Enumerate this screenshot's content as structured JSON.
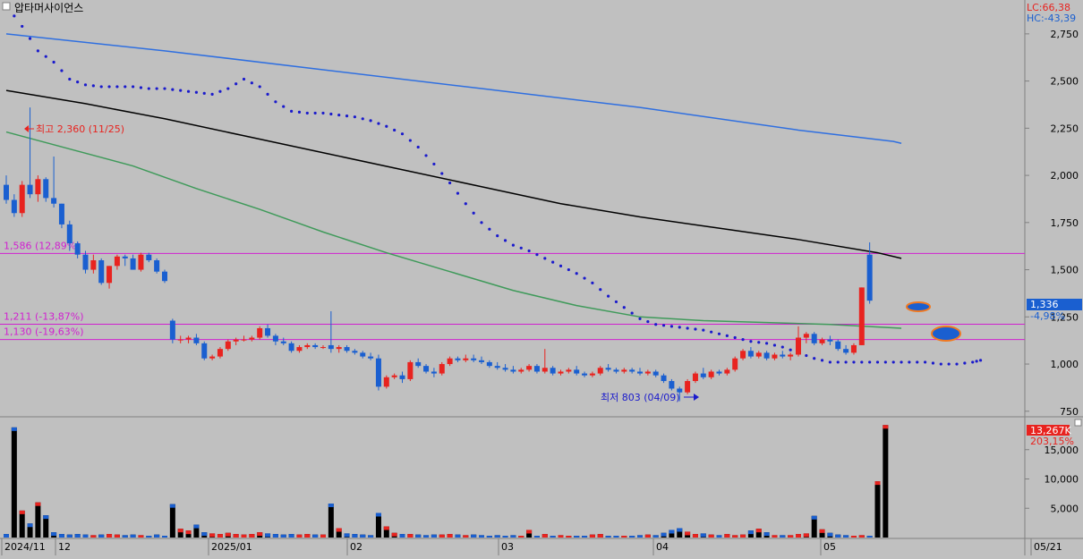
{
  "header": {
    "stock_name": "압타머사이언스",
    "lc_label": "LC:66,38",
    "hc_label": "HC:-43,39"
  },
  "colors": {
    "background": "#c0c0c0",
    "up": "#e8231f",
    "down": "#1a5fd0",
    "ma_blue": "#2f6fe0",
    "ma_black": "#000000",
    "ma_green": "#3f9a5a",
    "psar": "#1a1acc",
    "hline": "#d020d0",
    "annotation_high": "#e8231f",
    "annotation_low": "#1a1acc"
  },
  "chart_data": [
    {
      "type": "candlestick",
      "title": "",
      "y_ticks": [
        "2,750",
        "2,500",
        "2,250",
        "2,000",
        "1,750",
        "1,500",
        "1,250",
        "1,000",
        "750"
      ],
      "ylim": [
        730,
        2920
      ],
      "x_ticks": [
        "2024/11",
        "12",
        "2025/01",
        "02",
        "03",
        "04",
        "05",
        "05/21"
      ],
      "price_now_label": "1,336",
      "change_label": "-4,98%",
      "horizontal_lines": [
        {
          "value": 1586,
          "label": "1,586 (12,89%)"
        },
        {
          "value": 1211,
          "label": "1,211 (-13,87%)"
        },
        {
          "value": 1130,
          "label": "1,130 (-19,63%)"
        }
      ],
      "annotations": {
        "high_label": "최고 2,360 (11/25)",
        "low_label": "최저 803 (04/09)"
      },
      "candles": [
        [
          1950,
          2000,
          1850,
          1870
        ],
        [
          1870,
          1900,
          1780,
          1800
        ],
        [
          1800,
          1970,
          1780,
          1950
        ],
        [
          1950,
          2360,
          1880,
          1900
        ],
        [
          1900,
          2000,
          1860,
          1980
        ],
        [
          1980,
          1990,
          1860,
          1880
        ],
        [
          1880,
          2100,
          1830,
          1850
        ],
        [
          1850,
          1850,
          1720,
          1740
        ],
        [
          1740,
          1760,
          1600,
          1640
        ],
        [
          1640,
          1650,
          1560,
          1580
        ],
        [
          1580,
          1600,
          1480,
          1500
        ],
        [
          1500,
          1580,
          1480,
          1550
        ],
        [
          1550,
          1560,
          1420,
          1430
        ],
        [
          1430,
          1520,
          1400,
          1520
        ],
        [
          1520,
          1580,
          1500,
          1570
        ],
        [
          1570,
          1580,
          1520,
          1560
        ],
        [
          1560,
          1580,
          1500,
          1500
        ],
        [
          1500,
          1590,
          1490,
          1580
        ],
        [
          1580,
          1590,
          1540,
          1550
        ],
        [
          1550,
          1560,
          1480,
          1490
        ],
        [
          1490,
          1500,
          1430,
          1440
        ],
        [
          1230,
          1240,
          1110,
          1130
        ],
        [
          1130,
          1150,
          1110,
          1130
        ],
        [
          1130,
          1150,
          1110,
          1140
        ],
        [
          1140,
          1160,
          1100,
          1110
        ],
        [
          1110,
          1120,
          1020,
          1030
        ],
        [
          1030,
          1050,
          1020,
          1040
        ],
        [
          1040,
          1090,
          1030,
          1080
        ],
        [
          1080,
          1130,
          1070,
          1120
        ],
        [
          1120,
          1140,
          1100,
          1130
        ],
        [
          1130,
          1150,
          1120,
          1130
        ],
        [
          1130,
          1150,
          1120,
          1140
        ],
        [
          1140,
          1200,
          1130,
          1190
        ],
        [
          1190,
          1210,
          1140,
          1150
        ],
        [
          1150,
          1160,
          1100,
          1120
        ],
        [
          1120,
          1140,
          1100,
          1110
        ],
        [
          1110,
          1120,
          1060,
          1070
        ],
        [
          1070,
          1100,
          1060,
          1090
        ],
        [
          1090,
          1110,
          1080,
          1100
        ],
        [
          1100,
          1110,
          1080,
          1090
        ],
        [
          1090,
          1100,
          1080,
          1090
        ],
        [
          1100,
          1280,
          1060,
          1080
        ],
        [
          1080,
          1100,
          1060,
          1090
        ],
        [
          1090,
          1100,
          1060,
          1070
        ],
        [
          1070,
          1080,
          1050,
          1060
        ],
        [
          1060,
          1070,
          1030,
          1040
        ],
        [
          1040,
          1060,
          1020,
          1030
        ],
        [
          1030,
          1050,
          860,
          880
        ],
        [
          880,
          940,
          870,
          930
        ],
        [
          930,
          950,
          920,
          940
        ],
        [
          940,
          960,
          900,
          920
        ],
        [
          920,
          1020,
          910,
          1010
        ],
        [
          1010,
          1030,
          980,
          990
        ],
        [
          990,
          1000,
          950,
          960
        ],
        [
          960,
          980,
          930,
          950
        ],
        [
          950,
          1010,
          940,
          1000
        ],
        [
          1000,
          1040,
          990,
          1030
        ],
        [
          1030,
          1040,
          1010,
          1020
        ],
        [
          1020,
          1050,
          1010,
          1030
        ],
        [
          1030,
          1050,
          1010,
          1020
        ],
        [
          1020,
          1040,
          1000,
          1010
        ],
        [
          1010,
          1020,
          980,
          990
        ],
        [
          990,
          1010,
          970,
          980
        ],
        [
          980,
          1000,
          960,
          970
        ],
        [
          970,
          990,
          950,
          960
        ],
        [
          960,
          980,
          950,
          970
        ],
        [
          970,
          1000,
          960,
          990
        ],
        [
          990,
          1000,
          950,
          960
        ],
        [
          960,
          1080,
          950,
          980
        ],
        [
          980,
          990,
          940,
          950
        ],
        [
          950,
          970,
          940,
          960
        ],
        [
          960,
          980,
          950,
          970
        ],
        [
          970,
          990,
          940,
          950
        ],
        [
          950,
          960,
          930,
          940
        ],
        [
          940,
          960,
          930,
          950
        ],
        [
          950,
          990,
          940,
          980
        ],
        [
          980,
          1000,
          960,
          970
        ],
        [
          970,
          980,
          950,
          960
        ],
        [
          960,
          980,
          950,
          970
        ],
        [
          970,
          980,
          950,
          960
        ],
        [
          960,
          980,
          940,
          950
        ],
        [
          950,
          970,
          940,
          960
        ],
        [
          960,
          970,
          930,
          940
        ],
        [
          940,
          950,
          900,
          910
        ],
        [
          910,
          920,
          860,
          870
        ],
        [
          870,
          880,
          803,
          850
        ],
        [
          850,
          920,
          840,
          910
        ],
        [
          910,
          960,
          900,
          950
        ],
        [
          950,
          980,
          920,
          930
        ],
        [
          930,
          970,
          920,
          960
        ],
        [
          960,
          970,
          940,
          950
        ],
        [
          950,
          980,
          940,
          970
        ],
        [
          970,
          1040,
          960,
          1030
        ],
        [
          1030,
          1080,
          1020,
          1070
        ],
        [
          1070,
          1090,
          1030,
          1040
        ],
        [
          1040,
          1070,
          1030,
          1060
        ],
        [
          1060,
          1070,
          1020,
          1030
        ],
        [
          1030,
          1060,
          1020,
          1050
        ],
        [
          1050,
          1070,
          1030,
          1040
        ],
        [
          1040,
          1060,
          1020,
          1050
        ],
        [
          1050,
          1200,
          1040,
          1140
        ],
        [
          1140,
          1170,
          1110,
          1160
        ],
        [
          1160,
          1170,
          1100,
          1110
        ],
        [
          1110,
          1140,
          1100,
          1130
        ],
        [
          1130,
          1150,
          1100,
          1120
        ],
        [
          1120,
          1130,
          1070,
          1080
        ],
        [
          1080,
          1100,
          1050,
          1060
        ],
        [
          1060,
          1110,
          1050,
          1100
        ],
        [
          1100,
          1406,
          1100,
          1406
        ],
        [
          1580,
          1645,
          1320,
          1336
        ]
      ],
      "ma_blue": [
        [
          0,
          2750
        ],
        [
          20,
          2660
        ],
        [
          40,
          2560
        ],
        [
          60,
          2460
        ],
        [
          80,
          2360
        ],
        [
          100,
          2240
        ],
        [
          112,
          2180
        ],
        [
          113,
          2170
        ]
      ],
      "ma_black": [
        [
          0,
          2450
        ],
        [
          10,
          2380
        ],
        [
          20,
          2300
        ],
        [
          30,
          2210
        ],
        [
          40,
          2120
        ],
        [
          50,
          2030
        ],
        [
          60,
          1940
        ],
        [
          70,
          1850
        ],
        [
          80,
          1780
        ],
        [
          90,
          1720
        ],
        [
          100,
          1660
        ],
        [
          110,
          1590
        ],
        [
          113,
          1560
        ]
      ],
      "ma_green": [
        [
          0,
          2230
        ],
        [
          8,
          2140
        ],
        [
          16,
          2050
        ],
        [
          24,
          1930
        ],
        [
          32,
          1820
        ],
        [
          40,
          1700
        ],
        [
          48,
          1590
        ],
        [
          56,
          1490
        ],
        [
          64,
          1390
        ],
        [
          72,
          1310
        ],
        [
          80,
          1250
        ],
        [
          88,
          1230
        ],
        [
          96,
          1220
        ],
        [
          104,
          1210
        ],
        [
          113,
          1190
        ]
      ],
      "psar": [
        [
          0,
          2900
        ],
        [
          2,
          2790
        ],
        [
          4,
          2660
        ],
        [
          6,
          2600
        ],
        [
          8,
          2510
        ],
        [
          10,
          2480
        ],
        [
          12,
          2470
        ],
        [
          14,
          2470
        ],
        [
          16,
          2470
        ],
        [
          18,
          2460
        ],
        [
          20,
          2460
        ],
        [
          22,
          2450
        ],
        [
          24,
          2440
        ],
        [
          26,
          2430
        ],
        [
          28,
          2460
        ],
        [
          30,
          2510
        ],
        [
          32,
          2470
        ],
        [
          34,
          2390
        ],
        [
          36,
          2340
        ],
        [
          38,
          2330
        ],
        [
          40,
          2330
        ],
        [
          42,
          2320
        ],
        [
          44,
          2310
        ],
        [
          46,
          2290
        ],
        [
          48,
          2260
        ],
        [
          50,
          2220
        ],
        [
          52,
          2150
        ],
        [
          54,
          2060
        ],
        [
          56,
          1960
        ],
        [
          58,
          1850
        ],
        [
          60,
          1750
        ],
        [
          62,
          1680
        ],
        [
          64,
          1630
        ],
        [
          66,
          1600
        ],
        [
          68,
          1560
        ],
        [
          70,
          1520
        ],
        [
          72,
          1480
        ],
        [
          74,
          1430
        ],
        [
          76,
          1360
        ],
        [
          78,
          1300
        ],
        [
          80,
          1240
        ],
        [
          82,
          1210
        ],
        [
          84,
          1200
        ],
        [
          86,
          1190
        ],
        [
          88,
          1180
        ],
        [
          90,
          1160
        ],
        [
          92,
          1140
        ],
        [
          94,
          1120
        ],
        [
          96,
          1110
        ],
        [
          98,
          1090
        ],
        [
          100,
          1060
        ],
        [
          102,
          1030
        ],
        [
          104,
          1010
        ],
        [
          106,
          1010
        ],
        [
          108,
          1010
        ],
        [
          110,
          1010
        ],
        [
          112,
          1010
        ],
        [
          114,
          1010
        ],
        [
          116,
          1010
        ],
        [
          118,
          1000
        ],
        [
          120,
          1000
        ],
        [
          122,
          1010
        ],
        [
          123,
          1020
        ]
      ]
    },
    {
      "type": "bar",
      "title": "",
      "y_ticks": [
        "15,000",
        "10,000",
        "5,000"
      ],
      "ylim": [
        0,
        20000
      ],
      "volume_now_label": "13,267K",
      "volume_change_label": "203,15%",
      "values": [
        600,
        18800,
        4600,
        2400,
        6000,
        3800,
        900,
        600,
        500,
        600,
        500,
        400,
        500,
        600,
        500,
        400,
        500,
        400,
        300,
        500,
        300,
        5700,
        1500,
        1200,
        2200,
        900,
        700,
        600,
        800,
        600,
        500,
        600,
        900,
        700,
        600,
        500,
        600,
        500,
        600,
        500,
        500,
        5800,
        1600,
        700,
        600,
        500,
        400,
        4200,
        1900,
        800,
        600,
        600,
        500,
        400,
        500,
        500,
        600,
        500,
        400,
        500,
        400,
        300,
        400,
        300,
        400,
        300,
        1300,
        300,
        600,
        300,
        400,
        300,
        300,
        300,
        500,
        600,
        300,
        300,
        300,
        300,
        400,
        500,
        400,
        800,
        1300,
        1600,
        1000,
        600,
        700,
        500,
        400,
        600,
        400,
        500,
        1200,
        1500,
        900,
        400,
        400,
        400,
        600,
        700,
        3700,
        1400,
        800,
        500,
        400,
        300,
        400,
        300,
        9600,
        19200
      ]
    }
  ]
}
